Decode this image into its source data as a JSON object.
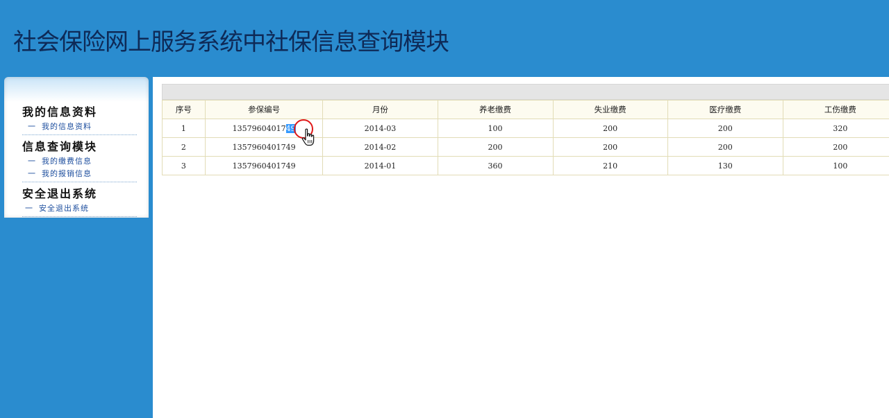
{
  "header": {
    "title": "社会保险网上服务系统中社保信息查询模块"
  },
  "sidebar": {
    "sections": [
      {
        "title": "我的信息资料",
        "links": [
          "我的信息资料"
        ]
      },
      {
        "title": "信息查询模块",
        "links": [
          "我的缴费信息",
          "我的报销信息"
        ]
      },
      {
        "title": "安全退出系统",
        "links": [
          "安全退出系统"
        ]
      }
    ],
    "link_dash": "一"
  },
  "table": {
    "columns": [
      "序号",
      "参保编号",
      "月份",
      "养老缴费",
      "失业缴费",
      "医疗缴费",
      "工伤缴费"
    ],
    "rows": [
      {
        "no": "1",
        "id_prefix": "13579604017",
        "id_selected": "49",
        "month": "2014-03",
        "pension": "100",
        "unemployment": "200",
        "medical": "200",
        "injury": "320"
      },
      {
        "no": "2",
        "id": "1357960401749",
        "month": "2014-02",
        "pension": "200",
        "unemployment": "200",
        "medical": "200",
        "injury": "200"
      },
      {
        "no": "3",
        "id": "1357960401749",
        "month": "2014-01",
        "pension": "360",
        "unemployment": "210",
        "medical": "130",
        "injury": "100"
      }
    ]
  },
  "colors": {
    "brand_blue": "#2a8ccf",
    "title_navy": "#0e2a57",
    "link_blue": "#1d4e9e",
    "selection": "#3399ff",
    "cursor_ring": "#e01818"
  }
}
